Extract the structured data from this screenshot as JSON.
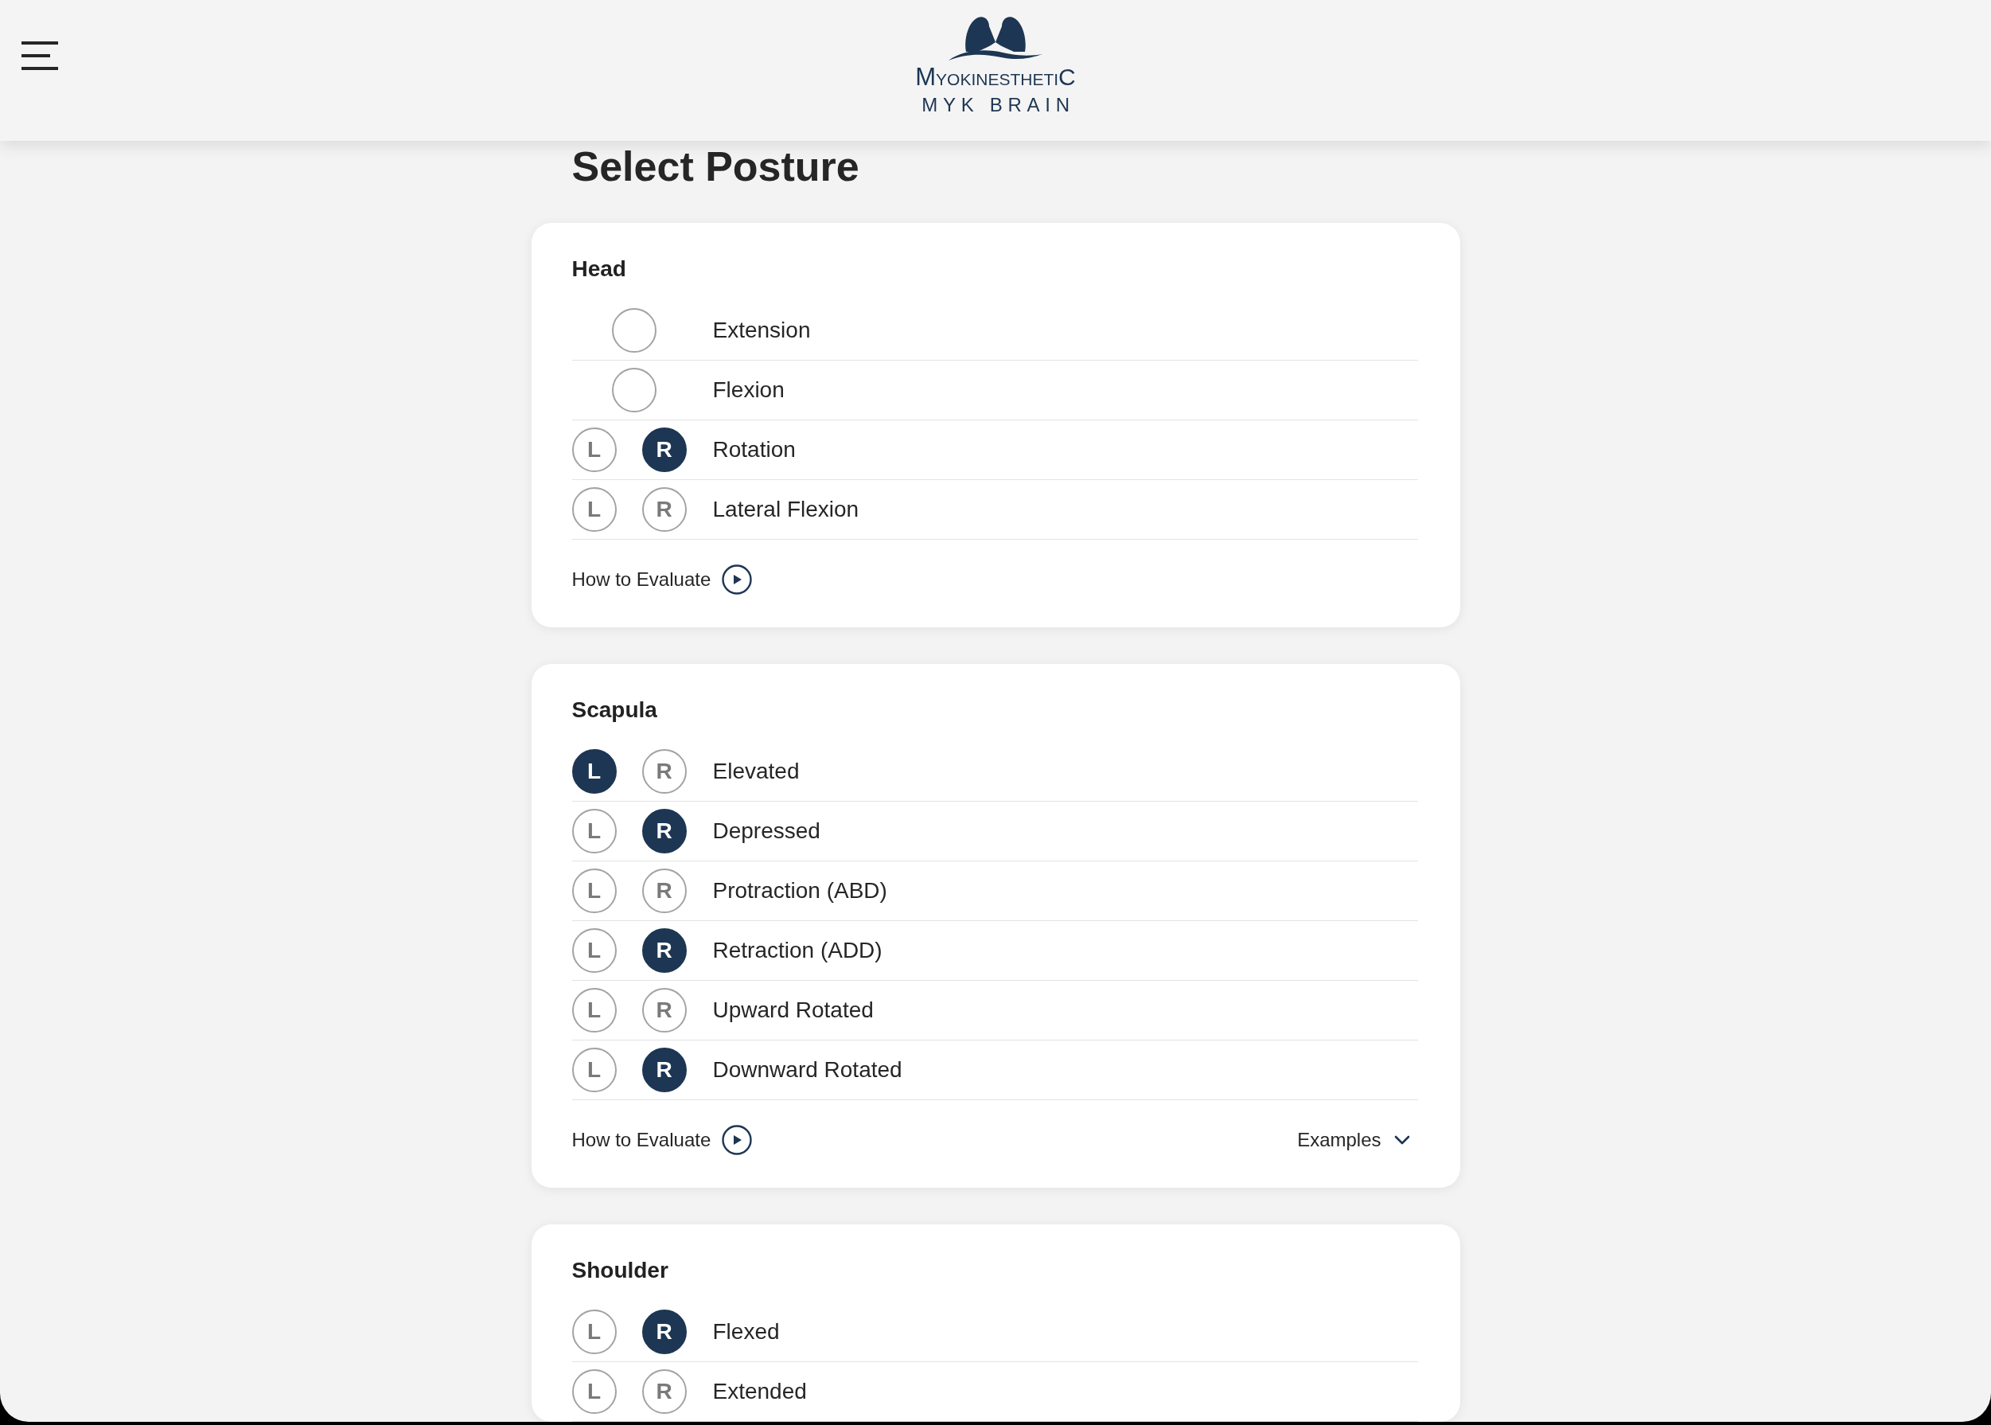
{
  "header": {
    "logo": {
      "wordmark": "MYOKINESTHETIC",
      "subtitle": "MYK BRAIN"
    }
  },
  "page_title": "Select Posture",
  "sections": [
    {
      "title": "Head",
      "items": [
        {
          "label": "Extension",
          "kind": "single",
          "selected": false
        },
        {
          "label": "Flexion",
          "kind": "single",
          "selected": false
        },
        {
          "label": "Rotation",
          "kind": "sided",
          "sides": [
            {
              "label": "L",
              "selected": false
            },
            {
              "label": "R",
              "selected": true
            }
          ]
        },
        {
          "label": "Lateral Flexion",
          "kind": "sided",
          "sides": [
            {
              "label": "L",
              "selected": false
            },
            {
              "label": "R",
              "selected": false
            }
          ]
        }
      ],
      "links": [
        {
          "kind": "evaluate",
          "label": "How to Evaluate"
        }
      ]
    },
    {
      "title": "Scapula",
      "items": [
        {
          "label": "Elevated",
          "kind": "sided",
          "sides": [
            {
              "label": "L",
              "selected": true
            },
            {
              "label": "R",
              "selected": false
            }
          ]
        },
        {
          "label": "Depressed",
          "kind": "sided",
          "sides": [
            {
              "label": "L",
              "selected": false
            },
            {
              "label": "R",
              "selected": true
            }
          ]
        },
        {
          "label": "Protraction (ABD)",
          "kind": "sided",
          "sides": [
            {
              "label": "L",
              "selected": false
            },
            {
              "label": "R",
              "selected": false
            }
          ]
        },
        {
          "label": "Retraction (ADD)",
          "kind": "sided",
          "sides": [
            {
              "label": "L",
              "selected": false
            },
            {
              "label": "R",
              "selected": true
            }
          ]
        },
        {
          "label": "Upward Rotated",
          "kind": "sided",
          "sides": [
            {
              "label": "L",
              "selected": false
            },
            {
              "label": "R",
              "selected": false
            }
          ]
        },
        {
          "label": "Downward Rotated",
          "kind": "sided",
          "sides": [
            {
              "label": "L",
              "selected": false
            },
            {
              "label": "R",
              "selected": true
            }
          ]
        }
      ],
      "links": [
        {
          "kind": "evaluate",
          "label": "How to Evaluate"
        },
        {
          "kind": "examples",
          "label": "Examples",
          "expanded": false
        }
      ]
    },
    {
      "title": "Shoulder",
      "items": [
        {
          "label": "Flexed",
          "kind": "sided",
          "sides": [
            {
              "label": "L",
              "selected": false
            },
            {
              "label": "R",
              "selected": true
            }
          ]
        },
        {
          "label": "Extended",
          "kind": "sided",
          "sides": [
            {
              "label": "L",
              "selected": false
            },
            {
              "label": "R",
              "selected": false
            }
          ]
        }
      ]
    }
  ]
}
